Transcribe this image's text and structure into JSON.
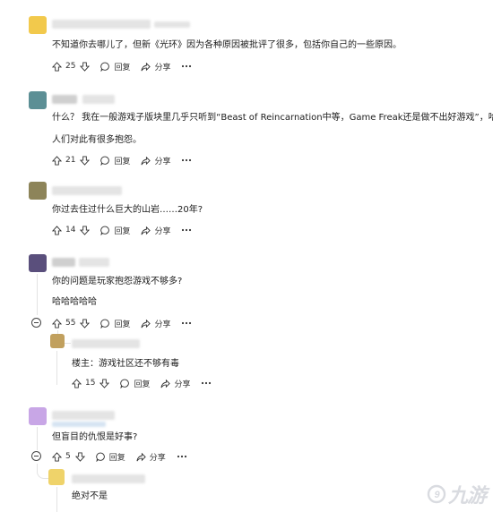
{
  "comments": [
    {
      "text": "不知道你去哪儿了，但新《光环》因为各种原因被批评了很多，包括你自己的一些原因。",
      "votes": "25",
      "reply": "回复",
      "share": "分享"
    },
    {
      "text": "什么？ 我在一般游戏子版块里几乎只听到“Beast of Reincarnation中等，Game Freak还是做不出好游戏”，哈哈。",
      "text2": "人们对此有很多抱怨。",
      "votes": "21",
      "reply": "回复",
      "share": "分享"
    },
    {
      "text": "你过去住过什么巨大的山岩……20年?",
      "votes": "14",
      "reply": "回复",
      "share": "分享"
    },
    {
      "text": "你的问题是玩家抱怨游戏不够多?",
      "text2": "哈哈哈哈哈",
      "votes": "55",
      "reply": "回复",
      "share": "分享"
    },
    {
      "text": "楼主：游戏社区还不够有毒",
      "votes": "15",
      "reply": "回复",
      "share": "分享"
    },
    {
      "text": "但盲目的仇恨是好事?",
      "votes": "5",
      "reply": "回复",
      "share": "分享"
    },
    {
      "text": "绝对不是"
    }
  ],
  "more_icon": "ellipsis-icon",
  "watermark": {
    "text": "九游",
    "mark": "9"
  },
  "colors": {
    "avatar_yellow": "#f2c94c",
    "avatar_teal": "#5c8f95",
    "avatar_olive": "#8d8459",
    "avatar_purple": "#5a4f7c",
    "avatar_lilac": "#c8a6e6"
  }
}
